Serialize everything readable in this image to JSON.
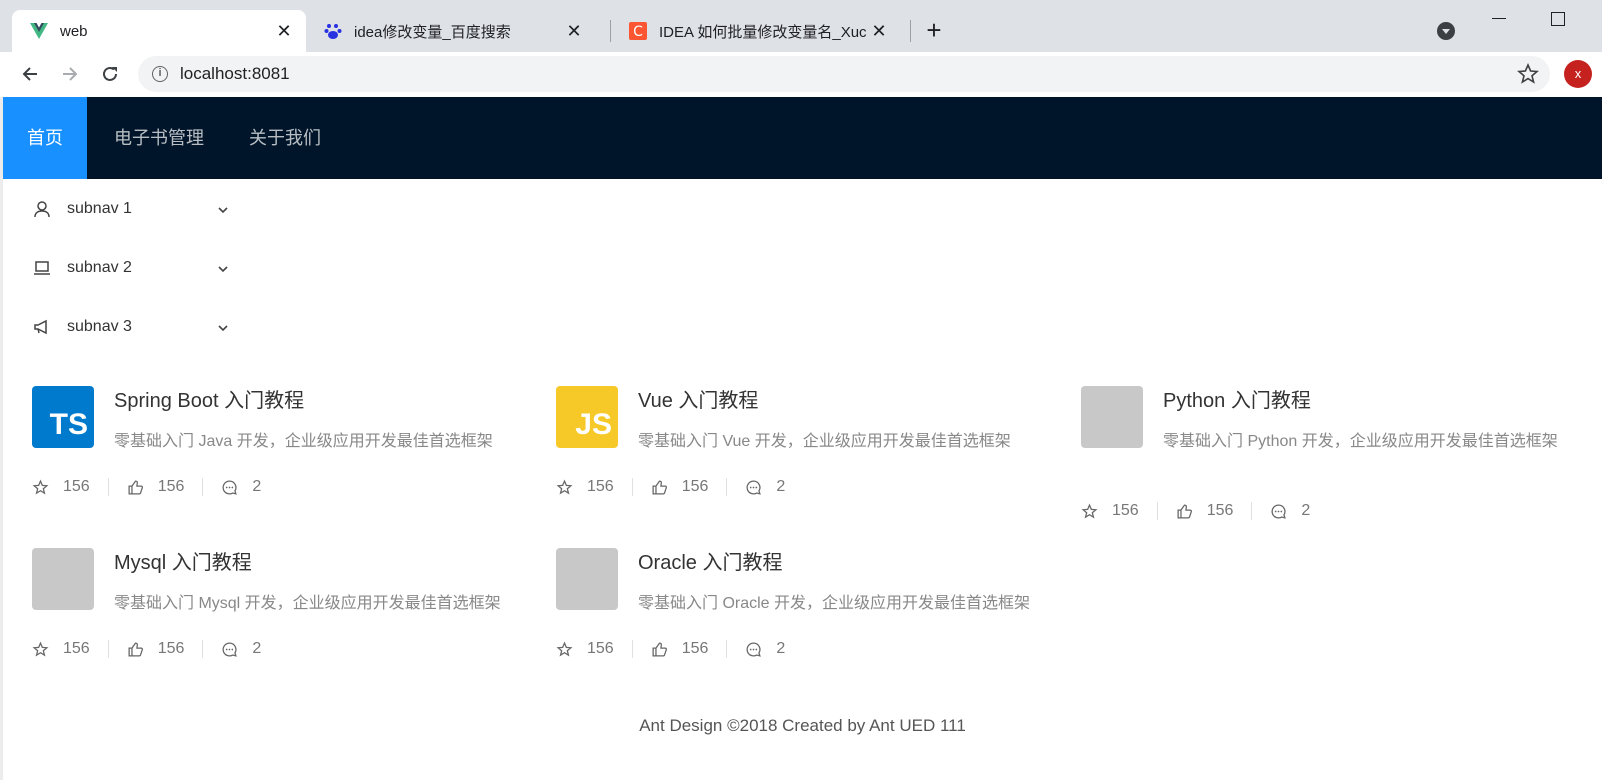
{
  "browser": {
    "tabs": [
      {
        "title": "web",
        "favicon": "vue-icon",
        "active": true
      },
      {
        "title": "idea修改变量_百度搜索",
        "favicon": "baidu-icon",
        "active": false
      },
      {
        "title": "IDEA 如何批量修改变量名_Xucc",
        "favicon": "csdn-icon",
        "active": false
      }
    ],
    "new_tab": "+",
    "url": "localhost:8081",
    "profile_initial": "x"
  },
  "header": {
    "menu": [
      {
        "label": "首页",
        "selected": true
      },
      {
        "label": "电子书管理",
        "selected": false
      },
      {
        "label": "关于我们",
        "selected": false
      }
    ]
  },
  "sider": {
    "items": [
      {
        "label": "subnav 1",
        "icon": "user-icon"
      },
      {
        "label": "subnav 2",
        "icon": "laptop-icon"
      },
      {
        "label": "subnav 3",
        "icon": "notification-icon"
      }
    ]
  },
  "ebooks": [
    {
      "name": "Spring Boot 入门教程",
      "desc": "零基础入门 Java 开发，企业级应用开发最佳首选框架",
      "thumb": "TS",
      "stars": "156",
      "likes": "156",
      "comments": "2"
    },
    {
      "name": "Vue 入门教程",
      "desc": "零基础入门 Vue 开发，企业级应用开发最佳首选框架",
      "thumb": "JS",
      "stars": "156",
      "likes": "156",
      "comments": "2"
    },
    {
      "name": "Python 入门教程",
      "desc": "零基础入门 Python 开发，企业级应用开发最佳首选框架",
      "thumb": "",
      "stars": "156",
      "likes": "156",
      "comments": "2"
    },
    {
      "name": "Mysql 入门教程",
      "desc": "零基础入门 Mysql 开发，企业级应用开发最佳首选框架",
      "thumb": "",
      "stars": "156",
      "likes": "156",
      "comments": "2"
    },
    {
      "name": "Oracle 入门教程",
      "desc": "零基础入门 Oracle 开发，企业级应用开发最佳首选框架",
      "thumb": "",
      "stars": "156",
      "likes": "156",
      "comments": "2"
    }
  ],
  "footer": "Ant Design ©2018 Created by Ant UED 111",
  "colors": {
    "header_bg": "#001529",
    "selected_bg": "#1890ff",
    "ts_bg": "#007acc",
    "js_bg": "#f7c928"
  }
}
